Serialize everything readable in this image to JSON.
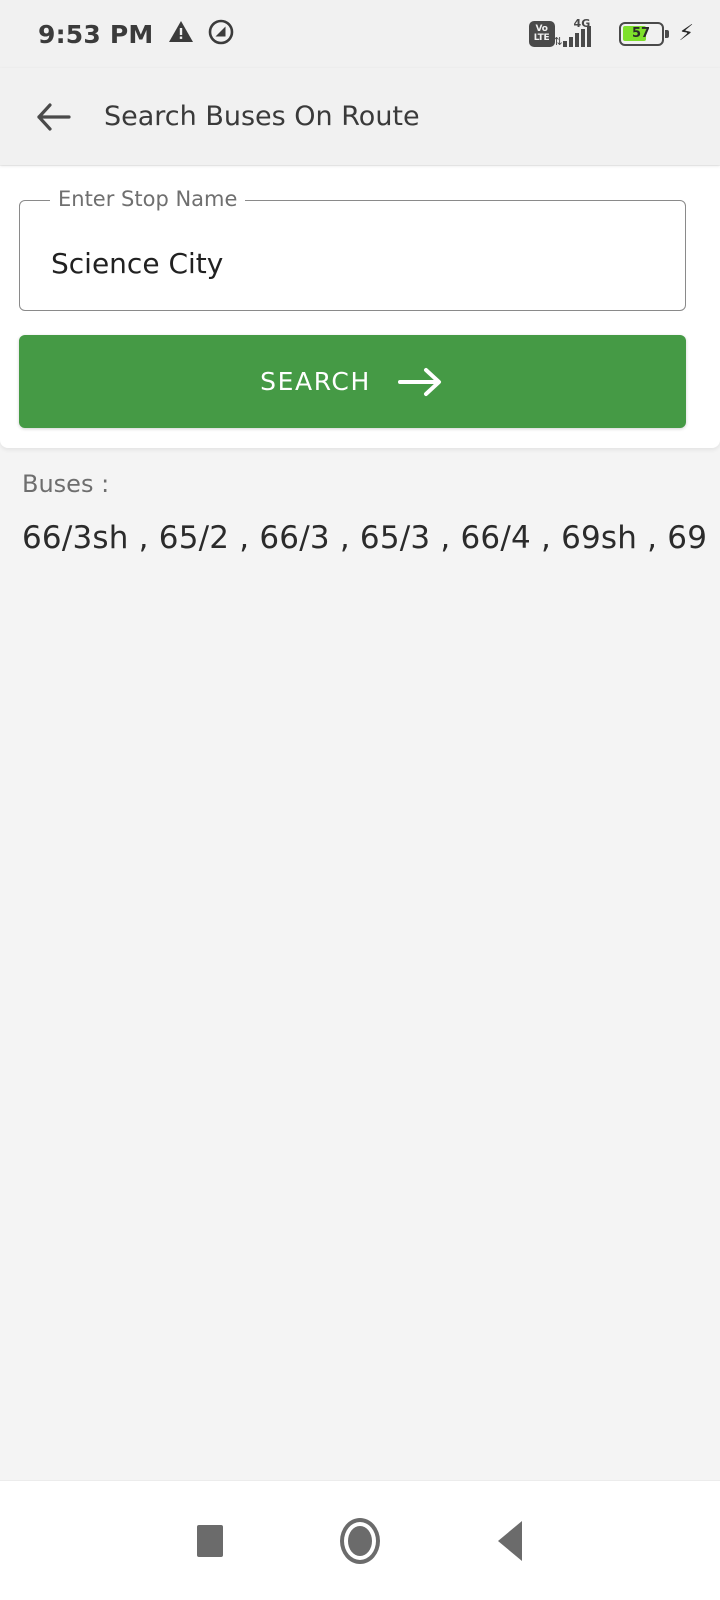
{
  "statusbar": {
    "time": "9:53 PM",
    "warning_icon": "warning-triangle-icon",
    "dnd_icon": "do-not-disturb-icon",
    "volte_top": "Vo",
    "volte_bottom": "LTE",
    "network_type": "4G",
    "data_arrows": "⇅",
    "battery_percent": "57",
    "battery_fill_pct": 57,
    "charging_icon": "⚡",
    "icon_color": "#4a4a4a",
    "battery_fill_color": "#7ee02b"
  },
  "appbar": {
    "back_icon": "arrow-left-icon",
    "title": "Search Buses On Route",
    "background": "#f1f1f1"
  },
  "search_form": {
    "field_label": "Enter Stop Name",
    "field_value": "Science City",
    "field_placeholder": "Enter Stop Name",
    "button_label": "SEARCH",
    "button_icon": "arrow-right-icon",
    "button_color": "#459a45"
  },
  "results": {
    "label": "Buses :",
    "buses": [
      "66/3sh",
      "65/2",
      "66/3",
      "65/3",
      "66/4",
      "69sh",
      "69"
    ],
    "buses_text": "66/3sh ,  65/2 ,  66/3 ,  65/3 ,  66/4 ,  69sh ,  69"
  },
  "navbar": {
    "recents_icon": "square-recents-icon",
    "home_icon": "circle-home-icon",
    "back_icon": "triangle-back-icon",
    "icon_color": "#6b6b6b"
  }
}
